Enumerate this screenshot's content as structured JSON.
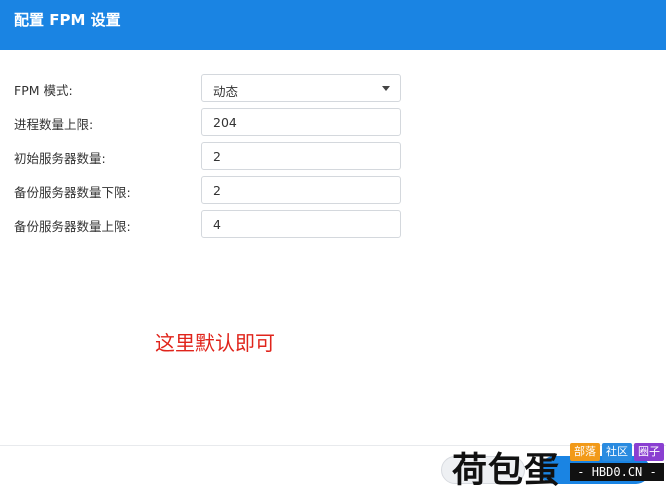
{
  "window": {
    "title": "配置 FPM 设置"
  },
  "form": {
    "rows": [
      {
        "label": "FPM 模式:",
        "value": "动态",
        "type": "select"
      },
      {
        "label": "进程数量上限:",
        "value": "204",
        "type": "input"
      },
      {
        "label": "初始服务器数量:",
        "value": "2",
        "type": "input"
      },
      {
        "label": "备份服务器数量下限:",
        "value": "2",
        "type": "input"
      },
      {
        "label": "备份服务器数量上限:",
        "value": "4",
        "type": "input"
      }
    ]
  },
  "annotation": {
    "text": "这里默认即可",
    "color": "#e0241b"
  },
  "watermark": {
    "main": "荷包蛋",
    "tags": [
      "部落",
      "社区",
      "圈子"
    ],
    "domain": "- HBD0.CN -"
  },
  "colors": {
    "accent": "#1a84e3"
  }
}
